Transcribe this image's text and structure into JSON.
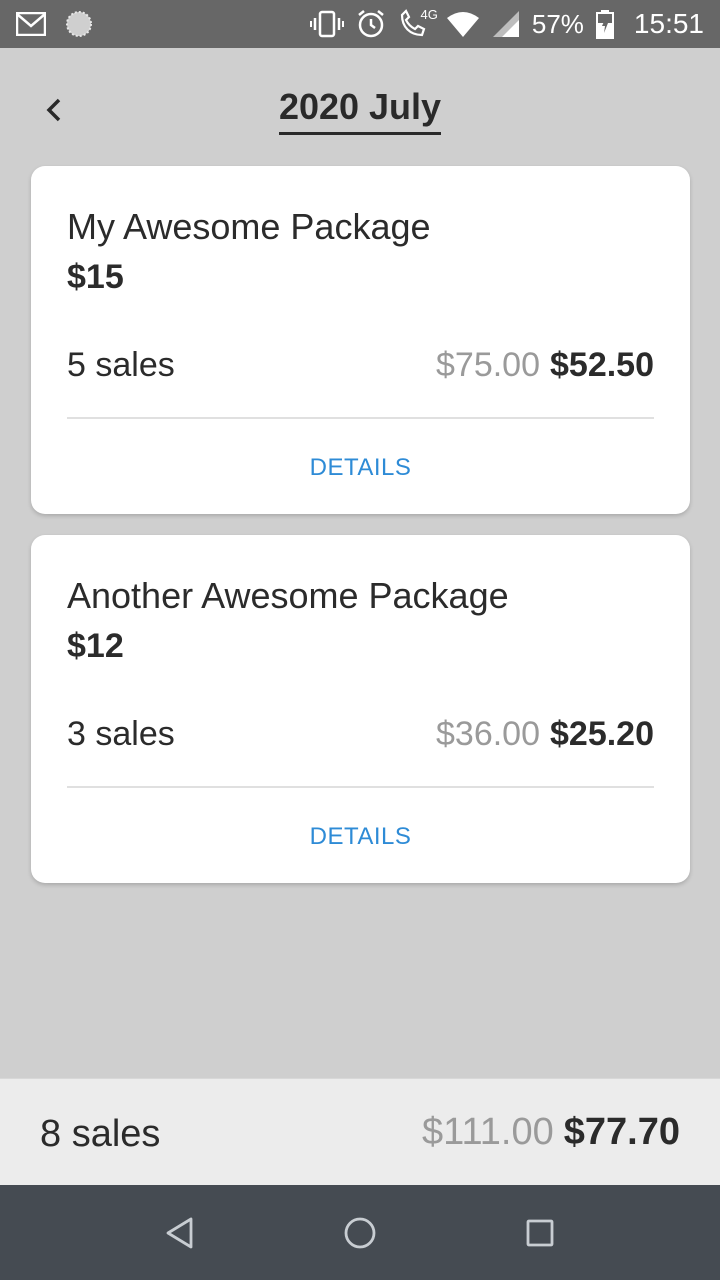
{
  "status_bar": {
    "battery": "57%",
    "time": "15:51",
    "network": "4G",
    "icons": [
      "gmail-icon",
      "loading-icon",
      "vibrate-icon",
      "alarm-icon",
      "volte-call-icon",
      "wifi-icon",
      "signal-icon",
      "battery-icon"
    ]
  },
  "header": {
    "title": "2020 July",
    "back_icon": "back-chevron-icon"
  },
  "packages": [
    {
      "name": "My Awesome Package",
      "price": "$15",
      "sales": "5 sales",
      "gross": "$75.00",
      "net": "$52.50",
      "details_label": "DETAILS"
    },
    {
      "name": "Another Awesome Package",
      "price": "$12",
      "sales": "3 sales",
      "gross": "$36.00",
      "net": "$25.20",
      "details_label": "DETAILS"
    }
  ],
  "summary": {
    "sales": "8 sales",
    "gross": "$111.00",
    "net": "$77.70"
  },
  "nav": {
    "icons": [
      "back-triangle-icon",
      "home-circle-icon",
      "recents-square-icon"
    ]
  },
  "colors": {
    "background": "#cfcfcf",
    "status_bar": "#676767",
    "accent": "#2e8bd6",
    "muted": "#9a9a9a",
    "navbar": "#454b52"
  }
}
